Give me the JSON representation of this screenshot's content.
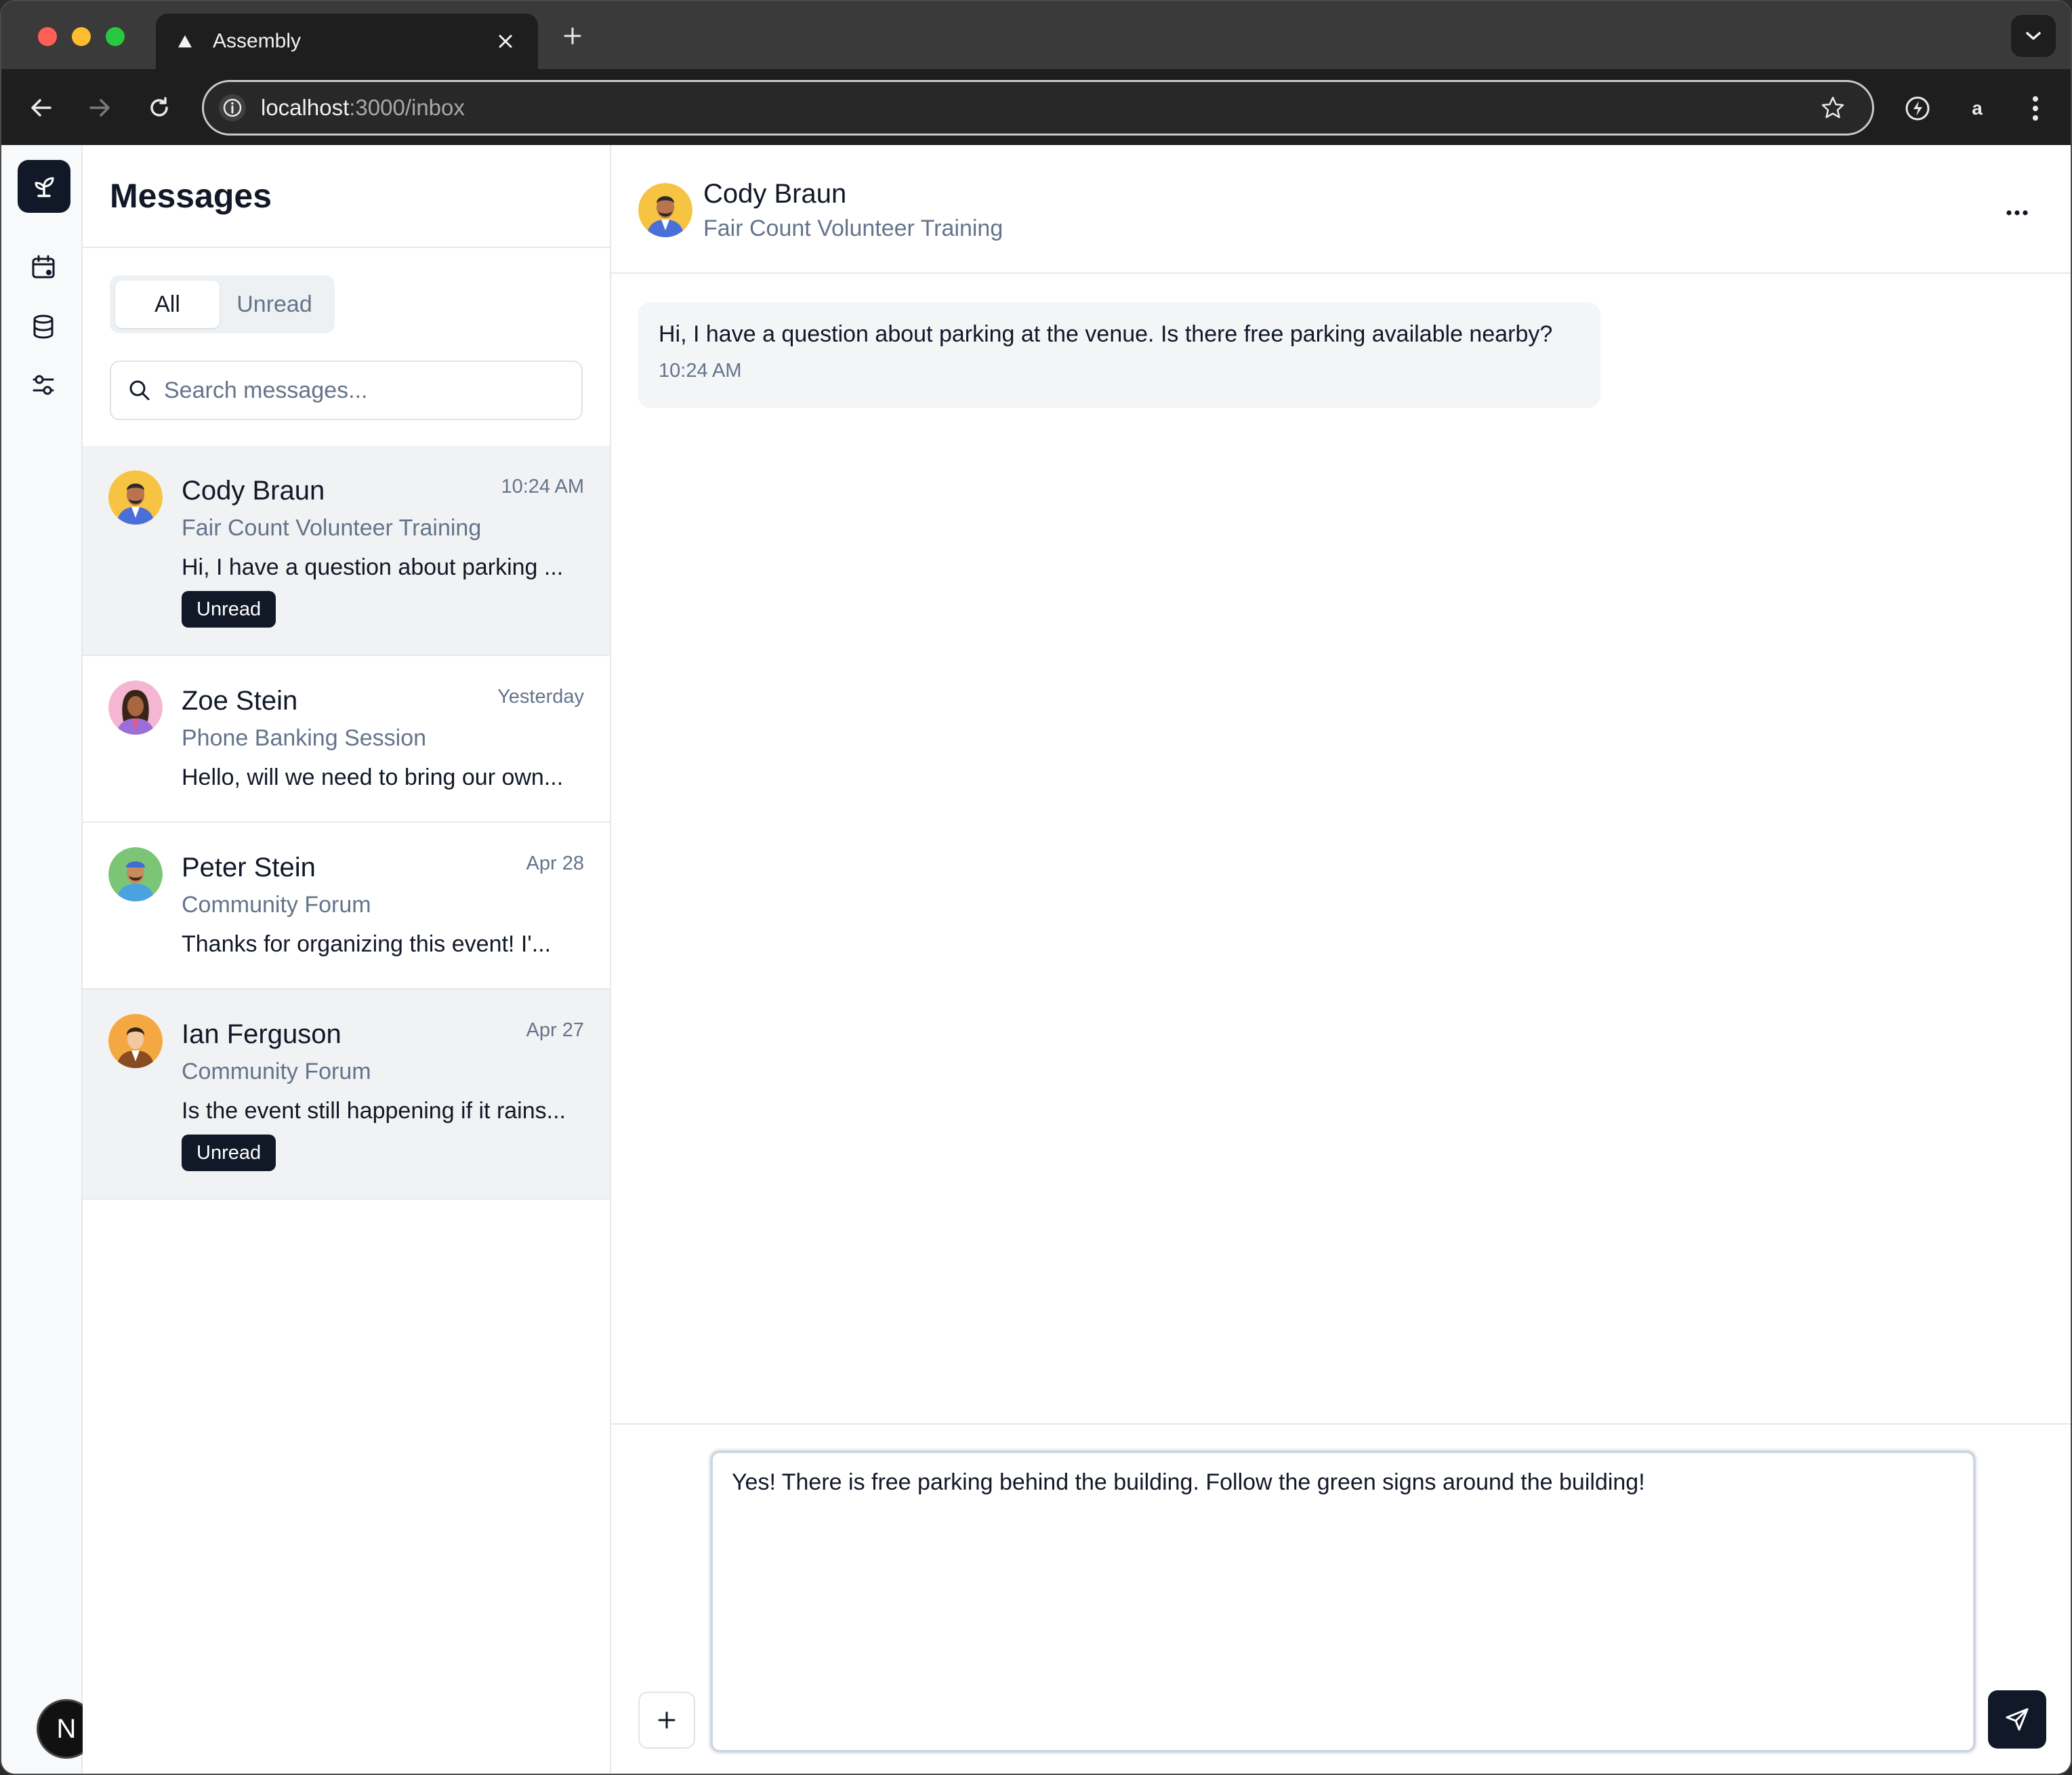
{
  "browser": {
    "tab_title": "Assembly",
    "url_host": "localhost",
    "url_path": ":3000/inbox"
  },
  "list": {
    "title": "Messages",
    "filters": [
      "All",
      "Unread"
    ],
    "search_placeholder": "Search messages...",
    "conversations": [
      {
        "name": "Cody Braun",
        "time": "10:24 AM",
        "event": "Fair Count Volunteer Training",
        "preview": "Hi, I have a question about parking ...",
        "badge": "Unread"
      },
      {
        "name": "Zoe Stein",
        "time": "Yesterday",
        "event": "Phone Banking Session",
        "preview": "Hello, will we need to bring our own...",
        "badge": ""
      },
      {
        "name": "Peter Stein",
        "time": "Apr 28",
        "event": "Community Forum",
        "preview": "Thanks for organizing this event! I'...",
        "badge": ""
      },
      {
        "name": "Ian Ferguson",
        "time": "Apr 27",
        "event": "Community Forum",
        "preview": "Is the event still happening if it rains...",
        "badge": "Unread"
      }
    ]
  },
  "thread": {
    "name": "Cody Braun",
    "event": "Fair Count Volunteer Training",
    "messages": [
      {
        "text": "Hi, I have a question about parking at the venue. Is there free parking available nearby?",
        "time": "10:24 AM"
      }
    ],
    "draft": "Yes! There is free parking behind the building. Follow the green signs around the building!"
  },
  "dev_badge": "N",
  "colors": {
    "accent_dark": "#111827",
    "muted_text": "#64748b",
    "selected_row": "#f1f2f4"
  }
}
